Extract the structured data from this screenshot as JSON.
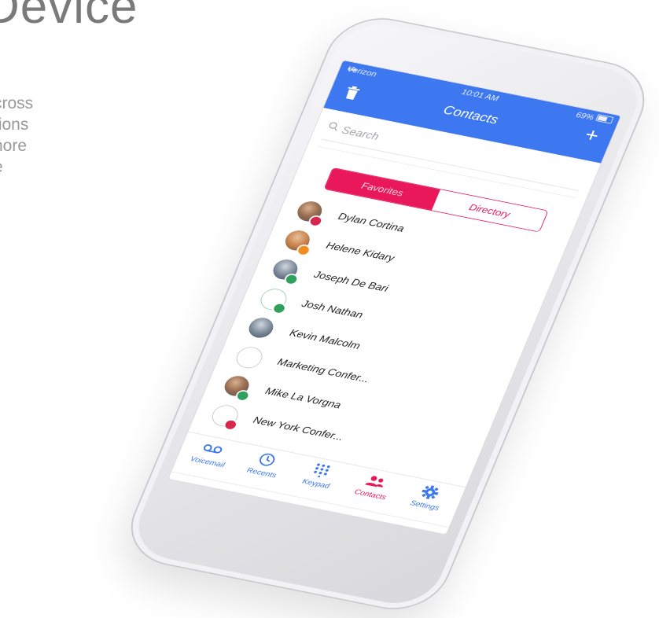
{
  "promo": {
    "headline": "Device",
    "blurb_lines": [
      "cross",
      "tions",
      "nore",
      "e"
    ]
  },
  "status_bar": {
    "carrier": "Verizon",
    "time": "10:01 AM",
    "battery": "69%"
  },
  "nav": {
    "title": "Contacts",
    "add_label": "+"
  },
  "search": {
    "placeholder": "Search"
  },
  "segments": {
    "favorites": "Favorites",
    "directory": "Directory",
    "selected": "Favorites"
  },
  "contacts": [
    {
      "name": "Dylan Cortina",
      "avatar": "photo",
      "presence": "busy",
      "presence_color": "#d8274c"
    },
    {
      "name": "Helene Kidary",
      "avatar": "photo",
      "presence": "away",
      "presence_color": "#f28c1f"
    },
    {
      "name": "Joseph De Bari",
      "avatar": "photo",
      "presence": "available",
      "presence_color": "#2fa15c"
    },
    {
      "name": "Josh Nathan",
      "avatar": "icon",
      "presence": "available",
      "presence_color": "#2fa15c"
    },
    {
      "name": "Kevin Malcolm",
      "avatar": "photo",
      "presence": "none",
      "presence_color": ""
    },
    {
      "name": "Marketing Confer...",
      "avatar": "conference-icon",
      "presence": "none",
      "presence_color": ""
    },
    {
      "name": "Mike La Vorgna",
      "avatar": "photo",
      "presence": "available",
      "presence_color": "#2fa15c"
    },
    {
      "name": "New York Confer...",
      "avatar": "conference-icon",
      "presence": "busy",
      "presence_color": "#d8274c"
    }
  ],
  "tabs": [
    {
      "label": "Voicemail",
      "icon": "voicemail-icon",
      "active": false
    },
    {
      "label": "Recents",
      "icon": "clock-icon",
      "active": false
    },
    {
      "label": "Keypad",
      "icon": "keypad-icon",
      "active": false
    },
    {
      "label": "Contacts",
      "icon": "contacts-icon",
      "active": true
    },
    {
      "label": "Settings",
      "icon": "gear-icon",
      "active": false
    }
  ],
  "colors": {
    "header_blue": "#3d78f0",
    "accent_pink": "#e8185a",
    "available_green": "#2fa15c",
    "busy_red": "#d8274c",
    "away_orange": "#f28c1f"
  }
}
